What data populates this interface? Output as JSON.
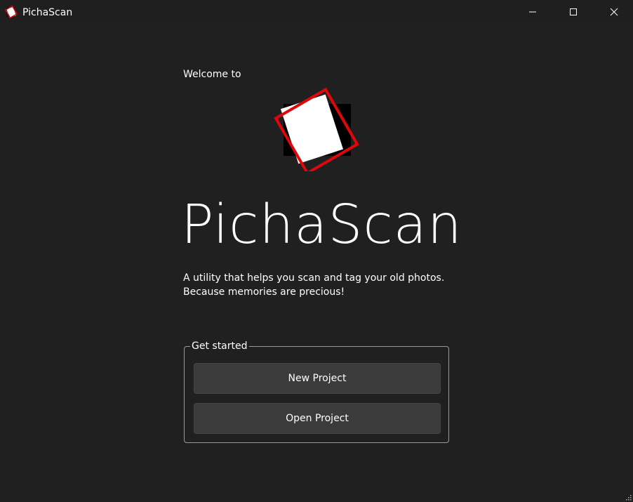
{
  "window": {
    "title": "PichaScan",
    "icons": {
      "app": "pichascan-logo-icon",
      "minimize": "minimize-icon",
      "maximize": "maximize-icon",
      "close": "close-icon"
    }
  },
  "main": {
    "welcome": "Welcome to",
    "app_name": "PichaScan",
    "tagline_line1": "A utility that helps you scan and tag your old photos.",
    "tagline_line2": "Because memories are precious!"
  },
  "get_started": {
    "legend": "Get started",
    "new_project_label": "New Project",
    "open_project_label": "Open Project"
  },
  "colors": {
    "background": "#202020",
    "button_bg": "#3b3b3b",
    "accent_red": "#e0060c",
    "text": "#ffffff"
  }
}
